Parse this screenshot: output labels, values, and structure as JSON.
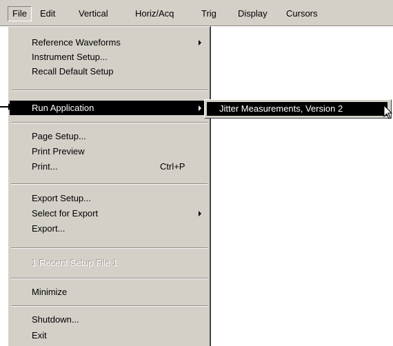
{
  "menubar": {
    "items": [
      "File",
      "Edit",
      "Vertical",
      "Horiz/Acq",
      "Trig",
      "Display",
      "Cursors"
    ]
  },
  "file_menu": {
    "reference_waveforms": "Reference Waveforms",
    "instrument_setup": "Instrument Setup...",
    "recall_default_setup": "Recall Default Setup",
    "run_application": "Run Application",
    "page_setup": "Page Setup...",
    "print_preview": "Print Preview",
    "print": "Print...",
    "print_shortcut": "Ctrl+P",
    "export_setup": "Export Setup...",
    "select_for_export": "Select for Export",
    "export": "Export...",
    "recent_setup_file": "1 Recent Setup File 1",
    "minimize": "Minimize",
    "shutdown": "Shutdown...",
    "exit": "Exit"
  },
  "submenu": {
    "item": "Jitter Measurements, Version 2"
  }
}
